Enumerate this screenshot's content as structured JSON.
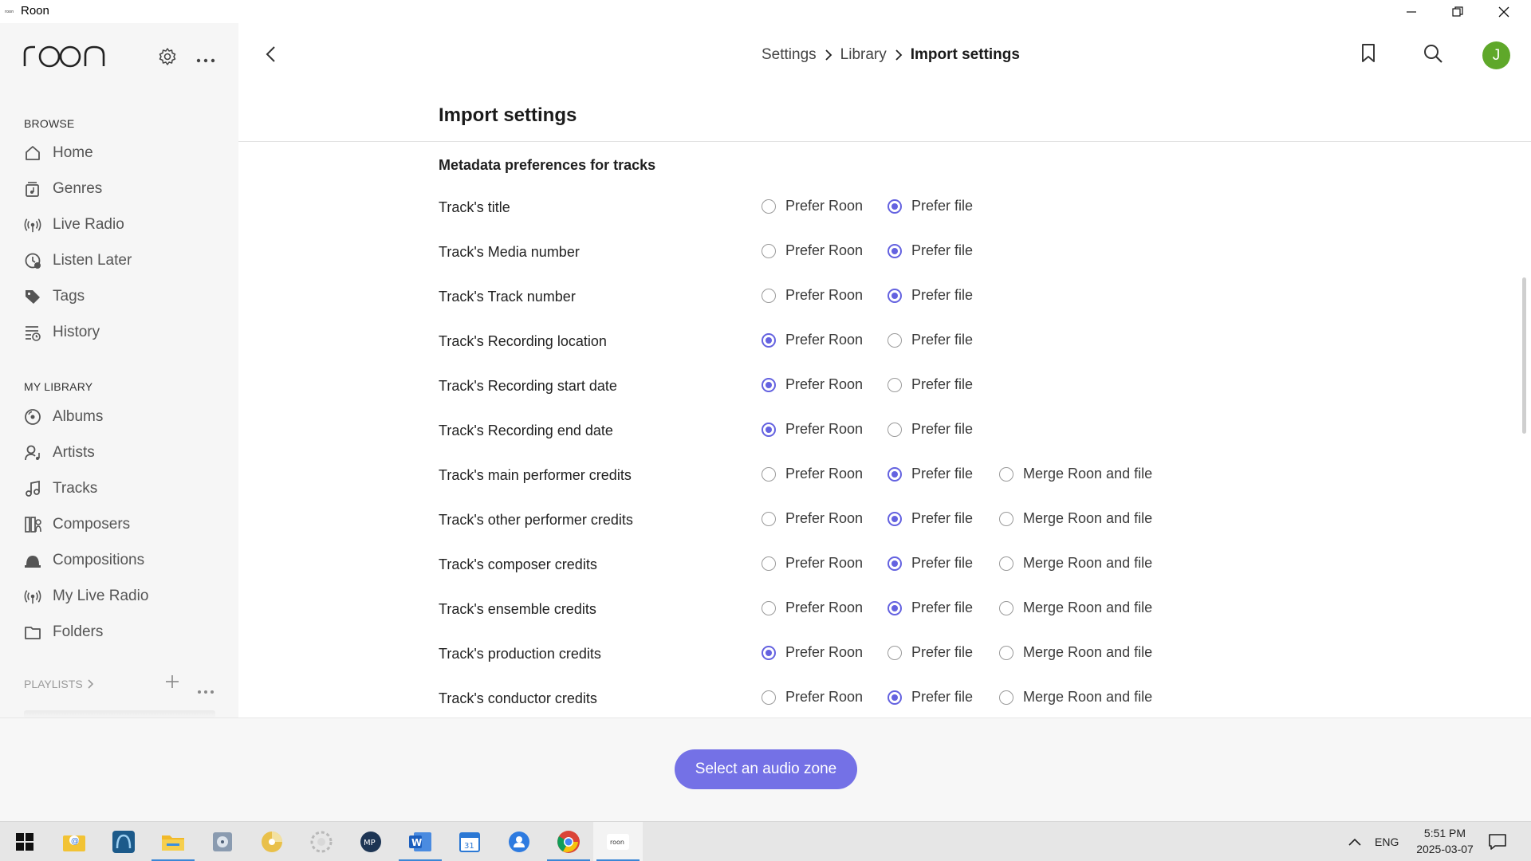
{
  "window": {
    "title": "Roon"
  },
  "sidebar": {
    "logo": "roon",
    "browse_label": "BROWSE",
    "browse_items": [
      {
        "label": "Home",
        "icon": "home-icon"
      },
      {
        "label": "Genres",
        "icon": "genres-icon"
      },
      {
        "label": "Live Radio",
        "icon": "radio-icon"
      },
      {
        "label": "Listen Later",
        "icon": "clock-icon"
      },
      {
        "label": "Tags",
        "icon": "tag-icon"
      },
      {
        "label": "History",
        "icon": "history-icon"
      }
    ],
    "library_label": "MY LIBRARY",
    "library_items": [
      {
        "label": "Albums",
        "icon": "album-icon"
      },
      {
        "label": "Artists",
        "icon": "artist-icon"
      },
      {
        "label": "Tracks",
        "icon": "music-note-icon"
      },
      {
        "label": "Composers",
        "icon": "composer-icon"
      },
      {
        "label": "Compositions",
        "icon": "composition-icon"
      },
      {
        "label": "My Live Radio",
        "icon": "radio-icon"
      },
      {
        "label": "Folders",
        "icon": "folder-icon"
      }
    ],
    "playlists_label": "PLAYLISTS"
  },
  "header": {
    "breadcrumb": [
      "Settings",
      "Library",
      "Import settings"
    ],
    "avatar_initial": "J"
  },
  "page": {
    "title": "Import settings",
    "section_heading": "Metadata preferences for tracks",
    "options": {
      "roon": "Prefer Roon",
      "file": "Prefer file",
      "merge": "Merge Roon and file"
    },
    "rows": [
      {
        "label": "Track's title",
        "selected": "file",
        "has_merge": false
      },
      {
        "label": "Track's Media number",
        "selected": "file",
        "has_merge": false
      },
      {
        "label": "Track's Track number",
        "selected": "file",
        "has_merge": false
      },
      {
        "label": "Track's Recording location",
        "selected": "roon",
        "has_merge": false
      },
      {
        "label": "Track's Recording start date",
        "selected": "roon",
        "has_merge": false
      },
      {
        "label": "Track's Recording end date",
        "selected": "roon",
        "has_merge": false
      },
      {
        "label": "Track's main performer credits",
        "selected": "file",
        "has_merge": true
      },
      {
        "label": "Track's other performer credits",
        "selected": "file",
        "has_merge": true
      },
      {
        "label": "Track's composer credits",
        "selected": "file",
        "has_merge": true
      },
      {
        "label": "Track's ensemble credits",
        "selected": "file",
        "has_merge": true
      },
      {
        "label": "Track's production credits",
        "selected": "roon",
        "has_merge": true
      },
      {
        "label": "Track's conductor credits",
        "selected": "file",
        "has_merge": true
      }
    ]
  },
  "footer": {
    "zone_button": "Select an audio zone"
  },
  "taskbar": {
    "apps": [
      "start-icon",
      "mail-app-icon",
      "audio-app-icon",
      "file-explorer-icon",
      "music-app-icon",
      "disc-app-icon",
      "settings-wheel-icon",
      "media-player-icon",
      "word-icon",
      "calendar-icon",
      "contacts-icon",
      "chrome-icon",
      "roon-app-icon"
    ],
    "language": "ENG",
    "time": "5:51 PM",
    "date": "2025-03-07"
  },
  "colors": {
    "accent": "#6462e0",
    "zone_button": "#7471e6",
    "avatar": "#5fa82a"
  }
}
